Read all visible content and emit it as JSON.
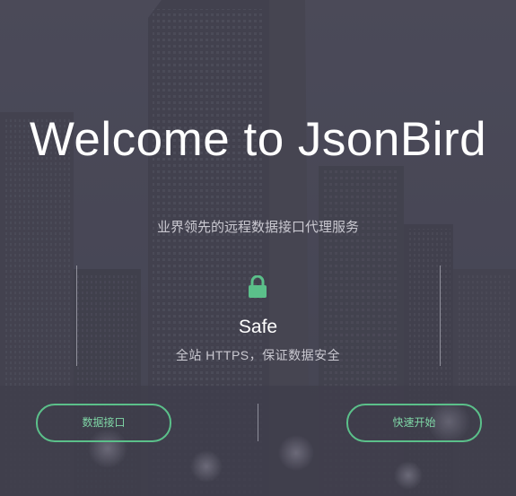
{
  "hero": {
    "title": "Welcome to JsonBird",
    "subtitle": "业界领先的远程数据接口代理服务"
  },
  "feature": {
    "icon": "lock-icon",
    "title": "Safe",
    "description": "全站 HTTPS，保证数据安全"
  },
  "actions": {
    "left_label": "数据接口",
    "right_label": "快速开始"
  },
  "colors": {
    "background": "#4a4957",
    "accent": "#5bc08a",
    "title_text": "#ffffff",
    "muted_text": "#c9c8d0"
  }
}
